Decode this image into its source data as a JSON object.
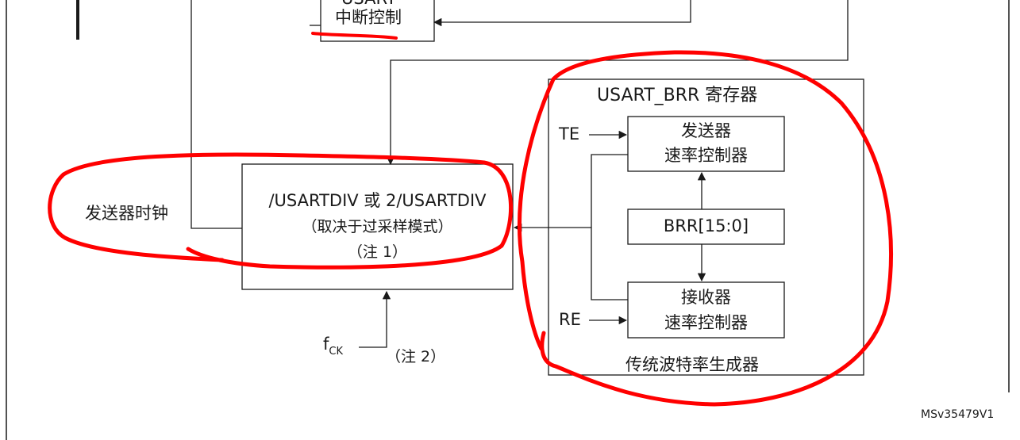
{
  "interrupt_box": {
    "title_partial": "USART",
    "label": "中断控制"
  },
  "baud_register_title": "USART_BRR 寄存器",
  "transmitter_rate": {
    "line1": "发送器",
    "line2": "速率控制器"
  },
  "brr_field": "BRR[15:0]",
  "receiver_rate": {
    "line1": "接收器",
    "line2": "速率控制器"
  },
  "divider_box": {
    "line1": "/USARTDIV 或 2/USARTDIV",
    "line2": "（取决于过采样模式）",
    "line3": "（注 1）"
  },
  "tx_clock_label": "发送器时钟",
  "te_label": "TE",
  "re_label": "RE",
  "fck_label": {
    "main": "f",
    "subscript": "CK"
  },
  "note2_label": "（注 2）",
  "generator_caption": "传统波特率生成器",
  "figure_id": "MSv35479V1",
  "annotation_color": "#ff0000",
  "line_color": "#1a1a1a"
}
